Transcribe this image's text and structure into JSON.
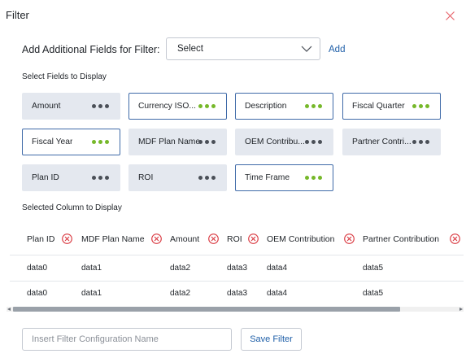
{
  "modal": {
    "title": "Filter",
    "close_icon": "close-icon"
  },
  "add_fields": {
    "label": "Add Additional Fields for Filter:",
    "select_value": "Select",
    "add_label": "Add"
  },
  "display_fields": {
    "label": "Select Fields to Display",
    "items": [
      {
        "label": "Amount",
        "selected": false
      },
      {
        "label": "Currency ISO...",
        "selected": true
      },
      {
        "label": "Description",
        "selected": true
      },
      {
        "label": "Fiscal Quarter",
        "selected": true
      },
      {
        "label": "Fiscal Year",
        "selected": true
      },
      {
        "label": "MDF Plan Name",
        "selected": false
      },
      {
        "label": "OEM Contribu...",
        "selected": false
      },
      {
        "label": "Partner Contri...",
        "selected": false
      },
      {
        "label": "Plan ID",
        "selected": false
      },
      {
        "label": "ROI",
        "selected": false
      },
      {
        "label": "Time Frame",
        "selected": true
      }
    ]
  },
  "selected_columns": {
    "label": "Selected Column to Display",
    "columns": [
      "Plan ID",
      "MDF Plan Name",
      "Amount",
      "ROI",
      "OEM Contribution",
      "Partner Contribution"
    ],
    "rows": [
      [
        "data0",
        "data1",
        "data2",
        "data3",
        "data4",
        "data5"
      ],
      [
        "data0",
        "data1",
        "data2",
        "data3",
        "data4",
        "data5"
      ]
    ]
  },
  "footer": {
    "config_placeholder": "Insert Filter Configuration Name",
    "save_label": "Save Filter"
  },
  "colors": {
    "accent_blue": "#1f5fa8",
    "selected_border": "#3f6aa8",
    "dot_green": "#76b82a",
    "remove_red": "#d9363e",
    "chip_bg": "#e4e8ef"
  }
}
